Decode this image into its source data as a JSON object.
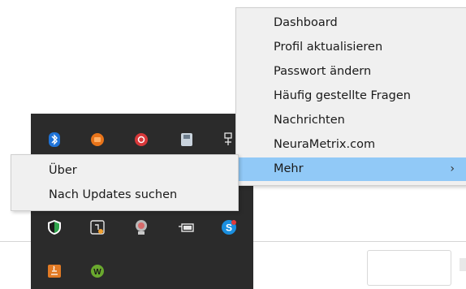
{
  "main_menu": {
    "items": [
      {
        "label": "Dashboard"
      },
      {
        "label": "Profil aktualisieren"
      },
      {
        "label": "Passwort ändern"
      },
      {
        "label": "Häufig gestellte Fragen"
      },
      {
        "label": "Nachrichten"
      },
      {
        "label": "NeuraMetrix.com"
      },
      {
        "label": "Mehr",
        "has_submenu": true,
        "highlighted": true
      }
    ],
    "submenu_chevron": "›"
  },
  "sub_menu": {
    "items": [
      {
        "label": "Über"
      },
      {
        "label": "Nach Updates suchen"
      }
    ]
  },
  "tray_icons": [
    {
      "name": "bluetooth-icon",
      "glyph": "ᛒ",
      "color": "#1e73d8"
    },
    {
      "name": "orange-app-icon",
      "glyph": "●",
      "color": "#e8741a"
    },
    {
      "name": "red-virus-app-icon",
      "glyph": "✱",
      "color": "#d8383a"
    },
    {
      "name": "disk-app-icon",
      "glyph": "▪",
      "color": "#c9d3dd"
    },
    {
      "name": "network-app-icon",
      "glyph": "□",
      "color": "#e6e6e6"
    },
    {
      "name": "shield-security-icon",
      "glyph": "◆",
      "color": "#2fa44c"
    },
    {
      "name": "sync-status-icon",
      "glyph": "⟳",
      "color": "#e6e6e6"
    },
    {
      "name": "red-circle-app-icon",
      "glyph": "◉",
      "color": "#d76b6b"
    },
    {
      "name": "battery-power-icon",
      "glyph": "▭",
      "color": "#e6e6e6"
    },
    {
      "name": "skype-icon",
      "glyph": "S",
      "color": "#1a8fe0"
    },
    {
      "name": "java-icon",
      "glyph": "♨",
      "color": "#e27a24"
    },
    {
      "name": "green-w-app-icon",
      "glyph": "W",
      "color": "#6aa92e"
    }
  ]
}
